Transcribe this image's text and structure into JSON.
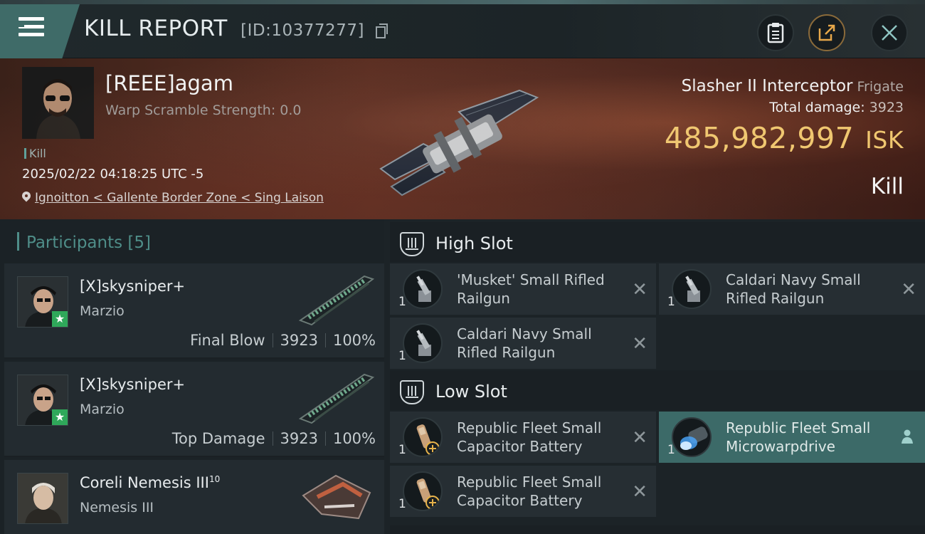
{
  "header": {
    "title": "KILL REPORT",
    "id_text": "[ID:10377277]",
    "buttons": [
      "clipboard-icon",
      "share-icon",
      "close-icon"
    ]
  },
  "victim": {
    "name": "[REEE]agam",
    "warp_scramble": "Warp Scramble Strength: 0.0",
    "tag": "Kill",
    "datetime": "2025/02/22 04:18:25 UTC -5",
    "location": "Ignoitton < Gallente Border Zone < Sing Laison",
    "ship_name": "Slasher II Interceptor",
    "ship_class": "Frigate",
    "total_damage_label": "Total damage:",
    "total_damage_value": "3923",
    "isk_value": "485,982,997",
    "isk_unit": "ISK",
    "result": "Kill"
  },
  "participants": {
    "title": "Participants",
    "count": "[5]",
    "items": [
      {
        "name": "[X]skysniper+",
        "corp": "Marzio",
        "role": "Final Blow",
        "damage": "3923",
        "percent": "100%"
      },
      {
        "name": "[X]skysniper+",
        "corp": "Marzio",
        "role": "Top Damage",
        "damage": "3923",
        "percent": "100%"
      },
      {
        "name": "Coreli Nemesis III",
        "level": "10",
        "corp": "Nemesis III"
      }
    ]
  },
  "slots": {
    "high": {
      "label": "High Slot",
      "modules": [
        {
          "qty": "1",
          "name_line1": "'Musket' Small Rifled",
          "name_line2": "Railgun"
        },
        {
          "qty": "1",
          "name_line1": "Caldari Navy Small",
          "name_line2": "Rifled Railgun"
        },
        {
          "qty": "1",
          "name_line1": "Caldari Navy Small",
          "name_line2": "Rifled Railgun"
        }
      ]
    },
    "low": {
      "label": "Low Slot",
      "modules": [
        {
          "qty": "1",
          "name_line1": "Republic Fleet Small",
          "name_line2": "Capacitor Battery"
        },
        {
          "qty": "1",
          "name_line1": "Republic Fleet Small",
          "name_line2": "Microwarpdrive"
        },
        {
          "qty": "1",
          "name_line1": "Republic Fleet Small",
          "name_line2": "Capacitor Battery"
        }
      ]
    }
  },
  "colors": {
    "accent": "#3f6b68",
    "isk": "#f0c770",
    "participants_title": "#4f8e89"
  }
}
